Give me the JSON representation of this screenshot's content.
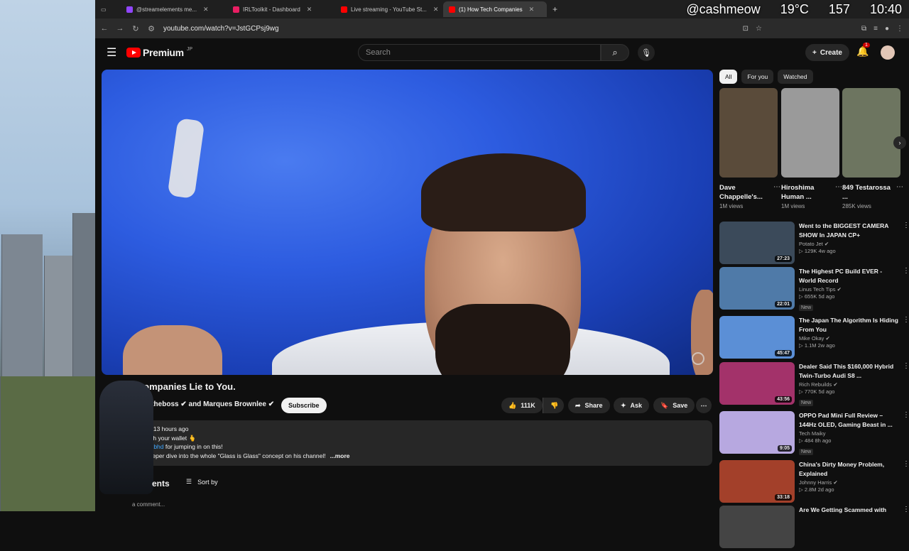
{
  "overlay": {
    "handle": "@cashmeow",
    "temp": "19°C",
    "count": "157",
    "time": "10:40"
  },
  "tabs": [
    {
      "label": "@streamelements me...",
      "active": false
    },
    {
      "label": "IRLToolkit - Dashboard",
      "active": false
    },
    {
      "label": "Live streaming - YouTube St...",
      "active": false
    },
    {
      "label": "(1) How Tech Companies",
      "active": true
    }
  ],
  "address": {
    "url": "youtube.com/watch?v=JstGCPsj9wg"
  },
  "header": {
    "brand": "Premium",
    "region": "JP",
    "search_placeholder": "Search",
    "create_label": "Create",
    "notif_count": "1"
  },
  "video": {
    "title": "ch Companies Lie to You.",
    "channels": "osetheboss ✔ and Marques Brownlee ✔",
    "subscribe_label": "Subscribe",
    "likes": "111K",
    "share_label": "Share",
    "ask_label": "Ask",
    "save_label": "Save",
    "desc_line1": "vs  13 hours ago",
    "desc_line2": "with your wallet 🫰",
    "desc_line3_link": "mkbhd",
    "desc_line3_rest": " for jumping in on this!",
    "desc_line4": "deeper dive into the whole \"Glass is Glass\" concept on his channel!",
    "desc_more": "...more",
    "comments_label": "ents",
    "sort_label": "Sort by",
    "add_comment": "a comment..."
  },
  "chips": [
    "All",
    "For you",
    "Watched"
  ],
  "shorts": [
    {
      "title": "Dave Chappelle's...",
      "views": "1M views",
      "color": "#5a4b3a"
    },
    {
      "title": "Hiroshima Human ...",
      "views": "1M views",
      "color": "#9a9a9a"
    },
    {
      "title": "849 Testarossa ...",
      "views": "285K views",
      "color": "#6d7560"
    }
  ],
  "recommendations": [
    {
      "title": "Went to the BIGGEST CAMERA SHOW In JAPAN CP+",
      "channel": "Potato Jet ✔",
      "views": "▷ 129K  4w ago",
      "duration": "27:23",
      "new": "",
      "color": "#3b4a5a"
    },
    {
      "title": "The Highest PC Build EVER - World Record",
      "channel": "Linus Tech Tips ✔",
      "views": "▷ 655K  5d ago",
      "duration": "22:01",
      "new": "New",
      "color": "#4f7aa8"
    },
    {
      "title": "The Japan The Algorithm Is Hiding From You",
      "channel": "Mike Okay ✔",
      "views": "▷ 1.1M  2w ago",
      "duration": "45:47",
      "new": "",
      "color": "#5b8fd6"
    },
    {
      "title": "Dealer Said This $160,000 Hybrid Twin-Turbo Audi S8 ...",
      "channel": "Rich Rebuilds ✔",
      "views": "▷ 770K  5d ago",
      "duration": "43:56",
      "new": "New",
      "color": "#a3326a"
    },
    {
      "title": "OPPO Pad Mini Full Review – 144Hz OLED, Gaming Beast in ...",
      "channel": "Tech Maiky",
      "views": "▷ 484  8h ago",
      "duration": "9:05",
      "new": "New",
      "color": "#b7a8e0"
    },
    {
      "title": "China's Dirty Money Problem, Explained",
      "channel": "Johnny Harris ✔",
      "views": "▷ 2.8M  2d ago",
      "duration": "33:18",
      "new": "",
      "color": "#a3402a"
    },
    {
      "title": "Are We Getting Scammed with",
      "channel": "",
      "views": "",
      "duration": "",
      "new": "",
      "color": "#444"
    }
  ]
}
